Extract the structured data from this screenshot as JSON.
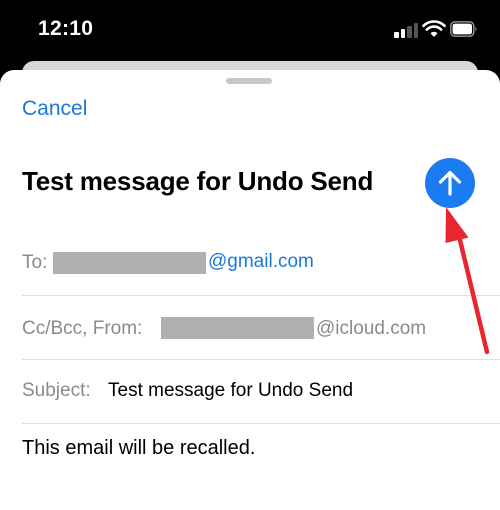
{
  "status": {
    "time": "12:10"
  },
  "compose": {
    "cancel_label": "Cancel",
    "title": "Test message for Undo Send",
    "to_label": "To:",
    "to_domain": "@gmail.com",
    "ccbcc_label": "Cc/Bcc, From:",
    "from_domain": "@icloud.com",
    "subject_label": "Subject:",
    "subject_value": "Test message for Undo Send",
    "body": "This email will be recalled."
  },
  "colors": {
    "accent": "#1a79d8",
    "send_button": "#1a7cf0",
    "annotation_arrow": "#e8262d"
  },
  "icons": {
    "send": "arrow-up-icon",
    "signal": "cellular-signal-icon",
    "wifi": "wifi-icon",
    "battery": "battery-icon"
  }
}
